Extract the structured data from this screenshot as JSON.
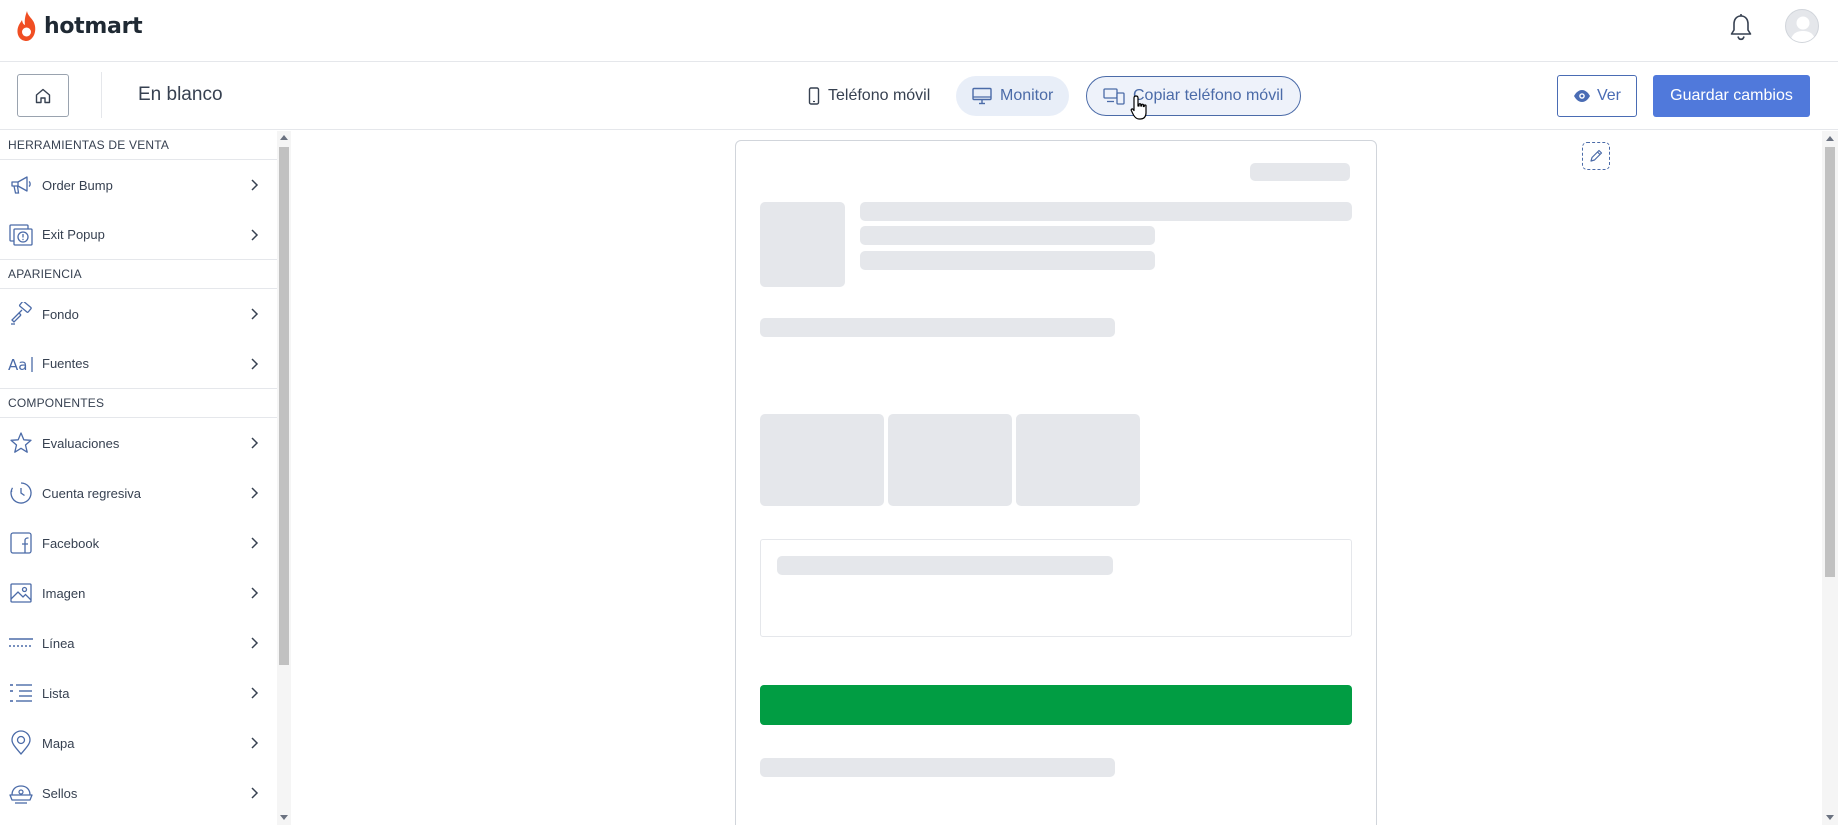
{
  "app": {
    "logo_text": "hotmart",
    "brand_color": "#f04e23"
  },
  "toolbar": {
    "page_title": "En blanco",
    "view_options": {
      "mobile_label": "Teléfono móvil",
      "monitor_label": "Monitor",
      "copy_label": "Copiar teléfono móvil"
    },
    "ver_label": "Ver",
    "save_label": "Guardar cambios",
    "accent_color": "#5079db"
  },
  "sidebar": {
    "sections": [
      {
        "title": "HERRAMIENTAS DE VENTA",
        "items": [
          {
            "label": "Order Bump",
            "icon": "megaphone-icon"
          },
          {
            "label": "Exit Popup",
            "icon": "exit-popup-icon"
          }
        ]
      },
      {
        "title": "APARIENCIA",
        "items": [
          {
            "label": "Fondo",
            "icon": "paint-roller-icon"
          },
          {
            "label": "Fuentes",
            "icon": "font-icon"
          }
        ]
      },
      {
        "title": "COMPONENTES",
        "items": [
          {
            "label": "Evaluaciones",
            "icon": "star-icon"
          },
          {
            "label": "Cuenta regresiva",
            "icon": "clock-icon"
          },
          {
            "label": "Facebook",
            "icon": "facebook-icon"
          },
          {
            "label": "Imagen",
            "icon": "image-icon"
          },
          {
            "label": "Línea",
            "icon": "line-icon"
          },
          {
            "label": "Lista",
            "icon": "list-icon"
          },
          {
            "label": "Mapa",
            "icon": "map-pin-icon"
          },
          {
            "label": "Sellos",
            "icon": "seal-icon"
          }
        ]
      }
    ]
  },
  "preview": {
    "cta_color": "#019d43"
  }
}
